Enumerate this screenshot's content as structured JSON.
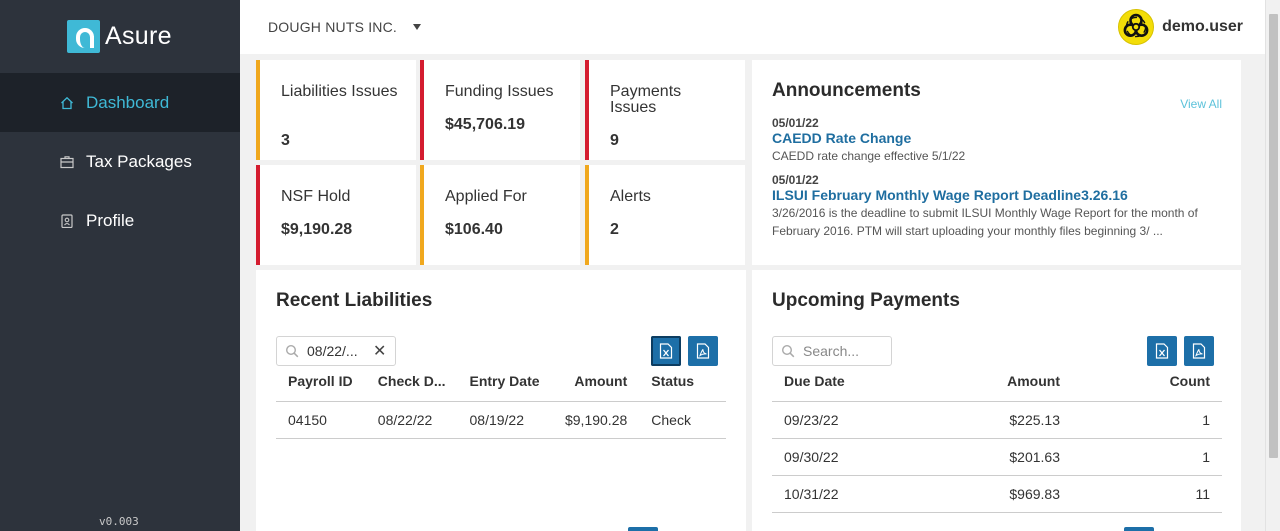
{
  "app": {
    "brand": "Asure",
    "version": "v0.003"
  },
  "sidebar": {
    "items": [
      {
        "label": "Dashboard",
        "icon": "home-icon",
        "active": true
      },
      {
        "label": "Tax Packages",
        "icon": "briefcase-icon",
        "active": false
      },
      {
        "label": "Profile",
        "icon": "id-badge-icon",
        "active": false
      }
    ]
  },
  "header": {
    "company": "DOUGH NUTS INC.",
    "user": "demo.user",
    "avatar_icon": "biohazard-icon"
  },
  "stats": [
    {
      "title": "Liabilities Issues",
      "value": "3",
      "accent": "#f0a81e"
    },
    {
      "title": "Funding Issues",
      "value": "$45,706.19",
      "accent": "#d41c2f"
    },
    {
      "title": "Payments Issues",
      "value": "9",
      "accent": "#d41c2f"
    },
    {
      "title": "NSF Hold",
      "value": "$9,190.28",
      "accent": "#d41c2f"
    },
    {
      "title": "Applied For",
      "value": "$106.40",
      "accent": "#f0a81e"
    },
    {
      "title": "Alerts",
      "value": "2",
      "accent": "#f0a81e"
    }
  ],
  "announcements": {
    "title": "Announcements",
    "view_all": "View All",
    "items": [
      {
        "date": "05/01/22",
        "title": "CAEDD Rate Change",
        "body": "CAEDD rate change effective 5/1/22"
      },
      {
        "date": "05/01/22",
        "title": "ILSUI February Monthly Wage Report Deadline3.26.16",
        "body": "3/26/2016 is the deadline to submit ILSUI Monthly Wage Report for the month of February 2016. PTM will start uploading your monthly files beginning 3/ ..."
      }
    ]
  },
  "recent_liabilities": {
    "title": "Recent Liabilities",
    "search_value": "08/22/...",
    "columns": [
      "Payroll ID",
      "Check D...",
      "Entry Date",
      "Amount",
      "Status"
    ],
    "rows": [
      [
        "04150",
        "08/22/22",
        "08/19/22",
        "$9,190.28",
        "Check"
      ]
    ]
  },
  "upcoming_payments": {
    "title": "Upcoming Payments",
    "search_placeholder": "Search...",
    "columns": [
      "Due Date",
      "Amount",
      "Count"
    ],
    "rows": [
      [
        "09/23/22",
        "$225.13",
        "1"
      ],
      [
        "09/30/22",
        "$201.63",
        "1"
      ],
      [
        "10/31/22",
        "$969.83",
        "11"
      ]
    ]
  },
  "colors": {
    "sidebar_bg": "#2d333c",
    "active_accent": "#3fb9d6",
    "warning": "#f0a81e",
    "danger": "#d41c2f",
    "button_blue": "#1d6fa8",
    "link_blue": "#1f6ea0"
  }
}
